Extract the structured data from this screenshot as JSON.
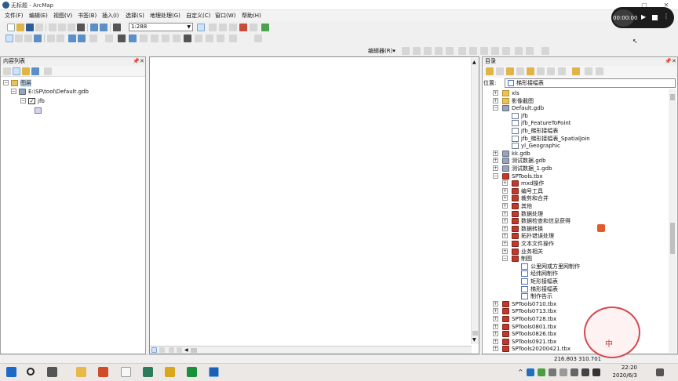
{
  "window": {
    "title": "无标题 - ArcMap"
  },
  "menubar": {
    "items": [
      "文件(F)",
      "编辑(E)",
      "视图(V)",
      "书签(B)",
      "插入(I)",
      "选择(S)",
      "地理处理(G)",
      "自定义(C)",
      "窗口(W)",
      "帮助(H)"
    ]
  },
  "toolbar": {
    "scale_value": "1:288",
    "editor_label": "编辑器(R)▾"
  },
  "toc": {
    "title": "内容列表",
    "layers": [
      {
        "label": "图层"
      },
      {
        "label": "E:\\SP\\tool\\Default.gdb"
      },
      {
        "label": "jfb"
      }
    ]
  },
  "catalog": {
    "title": "目录",
    "location_label": "位置:",
    "location_value": "梯形接幅表",
    "tree": [
      {
        "label": "xls",
        "icon": "folder"
      },
      {
        "label": "影像截图",
        "icon": "folder"
      },
      {
        "label": "Default.gdb",
        "icon": "gdb"
      },
      {
        "label": "jfb",
        "icon": "fc"
      },
      {
        "label": "jfb_FeatureToPoint",
        "icon": "fc"
      },
      {
        "label": "jfb_梯形接幅表",
        "icon": "fc"
      },
      {
        "label": "jfb_梯形接幅表_SpatialJoin",
        "icon": "fc"
      },
      {
        "label": "yl_Geographic",
        "icon": "fc"
      },
      {
        "label": "kk.gdb",
        "icon": "gdb"
      },
      {
        "label": "测试数据.gdb",
        "icon": "gdb"
      },
      {
        "label": "测试数据_1.gdb",
        "icon": "gdb"
      },
      {
        "label": "SPTools.tbx",
        "icon": "tbx"
      },
      {
        "label": "mxd操作",
        "icon": "tbx"
      },
      {
        "label": "编号工具",
        "icon": "tbx"
      },
      {
        "label": "裁剪和合并",
        "icon": "tbx"
      },
      {
        "label": "其他",
        "icon": "tbx"
      },
      {
        "label": "数据处理",
        "icon": "tbx"
      },
      {
        "label": "数据检查和信息获得",
        "icon": "tbx"
      },
      {
        "label": "数据转换",
        "icon": "tbx"
      },
      {
        "label": "拓扑错误处理",
        "icon": "tbx"
      },
      {
        "label": "文本文件操作",
        "icon": "tbx"
      },
      {
        "label": "业务相关",
        "icon": "tbx"
      },
      {
        "label": "制图",
        "icon": "tbx"
      },
      {
        "label": "公里网或方里网制作",
        "icon": "tool"
      },
      {
        "label": "经纬网制作",
        "icon": "tool"
      },
      {
        "label": "矩形接幅表",
        "icon": "tool"
      },
      {
        "label": "梯形接幅表",
        "icon": "tool"
      },
      {
        "label": "制作告示",
        "icon": "tool"
      },
      {
        "label": "SPTools0710.tbx",
        "icon": "tbx"
      },
      {
        "label": "SPTools0713.tbx",
        "icon": "tbx"
      },
      {
        "label": "SPTools0728.tbx",
        "icon": "tbx"
      },
      {
        "label": "SPTools0801.tbx",
        "icon": "tbx"
      },
      {
        "label": "SPTools0826.tbx",
        "icon": "tbx"
      },
      {
        "label": "SPTools0921.tbx",
        "icon": "tbx"
      },
      {
        "label": "SPTools20200421.tbx",
        "icon": "tbx"
      }
    ]
  },
  "status": {
    "coordinates": "216.803  310.701"
  },
  "taskbar": {
    "time": "22:20",
    "date": "2020/6/3"
  },
  "recorder": {
    "time": "00:00:00"
  },
  "seal": {
    "char": "中"
  }
}
